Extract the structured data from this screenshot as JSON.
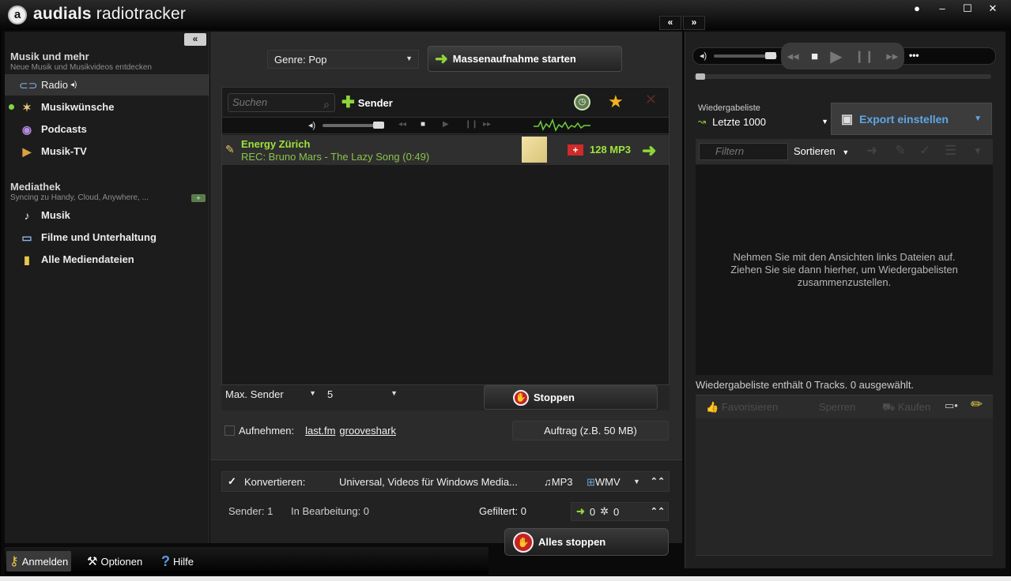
{
  "app": {
    "title_bold": "audials",
    "title_rest": " radiotracker",
    "window_buttons": [
      "●",
      "–",
      "☐",
      "✕"
    ],
    "collapse_left": "«",
    "collapse_right": "»"
  },
  "sidebar": {
    "collapse": "«",
    "section1": {
      "title": "Musik und mehr",
      "subtitle": "Neue Musik und Musikvideos entdecken"
    },
    "items": [
      {
        "label": "Radio",
        "icon": "radio-icon",
        "selected": true
      },
      {
        "label": "Musikwünsche",
        "icon": "wish-icon"
      },
      {
        "label": "Podcasts",
        "icon": "podcast-icon"
      },
      {
        "label": "Musik-TV",
        "icon": "tv-icon"
      }
    ],
    "section2": {
      "title": "Mediathek",
      "subtitle": "Syncing zu Handy, Cloud, Anywhere, ..."
    },
    "media_items": [
      {
        "label": "Musik",
        "icon": "music-note-icon"
      },
      {
        "label": "Filme und Unterhaltung",
        "icon": "monitor-icon"
      },
      {
        "label": "Alle Mediendateien",
        "icon": "folder-icon"
      }
    ]
  },
  "bottom_bar": {
    "login": "Anmelden",
    "options": "Optionen",
    "help": "Hilfe"
  },
  "main": {
    "genre": "Genre: Pop",
    "mass_record": "Massenaufnahme starten",
    "search_placeholder": "Suchen",
    "add_sender": "Sender",
    "station": {
      "name": "Energy Zürich",
      "recording": "REC: Bruno Mars - The Lazy Song (0:49)",
      "bitrate": "128 MP3",
      "flag": "+"
    },
    "max_sender_label": "Max. Sender",
    "max_sender_value": "5",
    "stop": "Stoppen",
    "record_label": "Aufnehmen:",
    "link_lastfm": "last.fm",
    "link_grooveshark": "grooveshark",
    "auftrag": "Auftrag (z.B. 50 MB)",
    "convert_label": "Konvertieren:",
    "convert_value": "Universal, Videos für Windows Media...",
    "format_mp3": "MP3",
    "format_wmv": "WMV",
    "status_sender": "Sender: 1",
    "status_processing": "In Bearbeitung: 0",
    "status_filtered": "Gefiltert: 0",
    "count_done": "0",
    "count_settings": "0",
    "stop_all": "Alles stoppen"
  },
  "right": {
    "playlist_label": "Wiedergabeliste",
    "playlist_value": "Letzte 1000",
    "export": "Export einstellen",
    "filter_placeholder": "Filtern",
    "sort": "Sortieren",
    "empty_line1": "Nehmen Sie mit den Ansichten links Dateien auf.",
    "empty_line2": "Ziehen Sie sie dann hierher, um Wiedergabelisten",
    "empty_line3": "zusammenzustellen.",
    "status": "Wiedergabeliste enthält 0 Tracks. 0 ausgewählt.",
    "favorite": "Favorisieren",
    "block": "Sperren",
    "buy": "Kaufen",
    "more": "•••"
  },
  "colors": {
    "accent_green": "#9ee33b",
    "export_blue": "#5fa6e6",
    "stop_red": "#c52222"
  }
}
